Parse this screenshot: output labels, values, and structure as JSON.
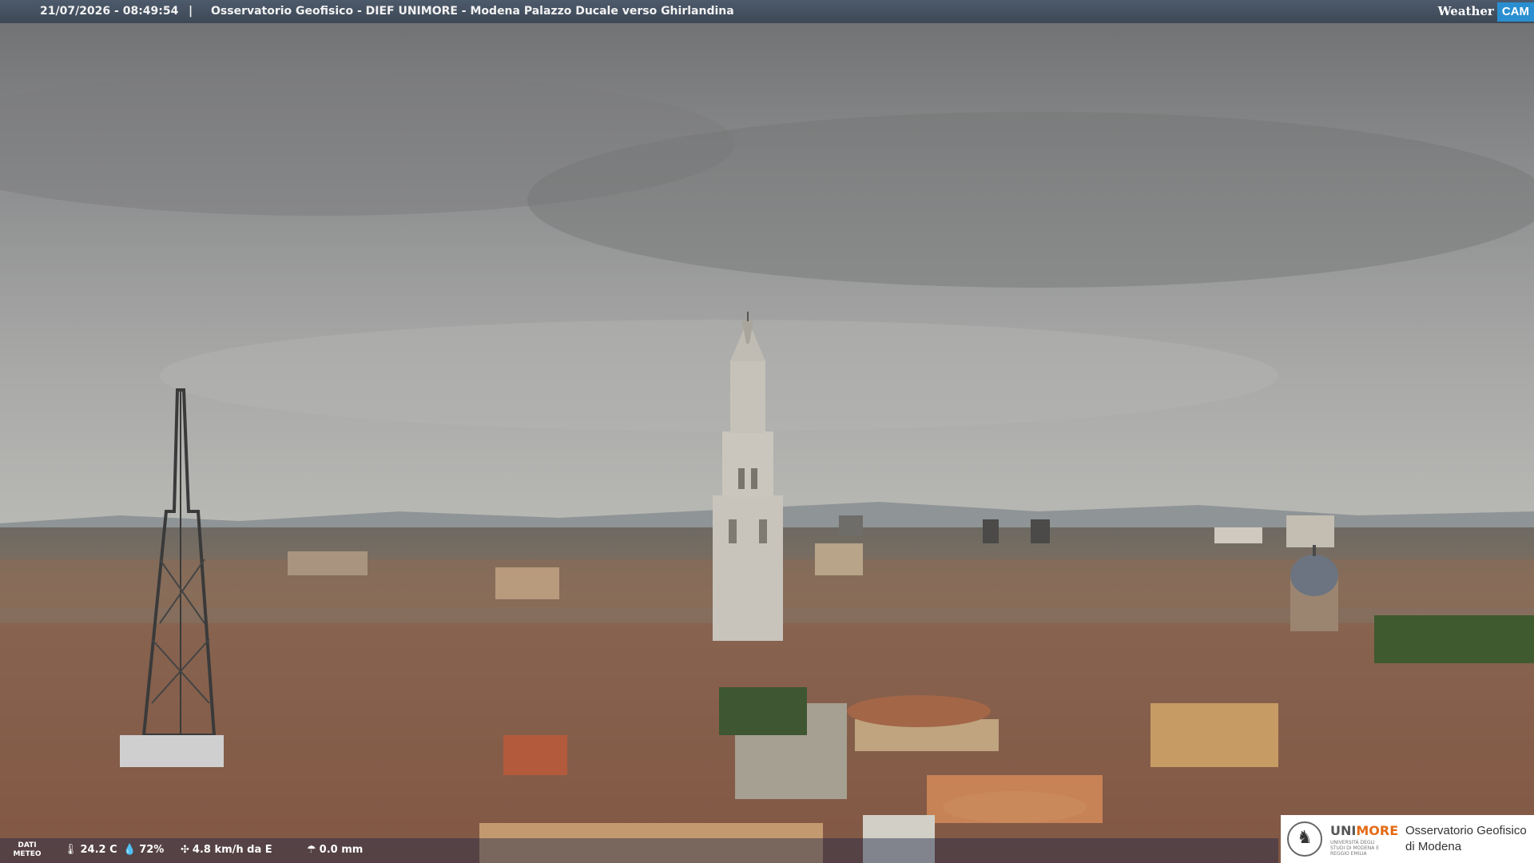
{
  "header": {
    "timestamp": "21/07/2026 - 08:49:54",
    "separator": "|",
    "title": "Osservatorio Geofisico - DIEF UNIMORE - Modena Palazzo Ducale verso Ghirlandina",
    "logo_weather": "Weather",
    "logo_cam": "CAM"
  },
  "weather": {
    "label": "DATI METEO",
    "temperature": "24.2 C",
    "humidity": "72%",
    "wind": "4.8 km/h da E",
    "rain": "0.0 mm"
  },
  "footer_logo": {
    "brand_left": "UNI",
    "brand_right": "MORE",
    "subtitle": "UNIVERSITÀ DEGLI STUDI DI MODENA E REGGIO EMILIA",
    "observatory_line1": "Osservatorio Geofisico",
    "observatory_line2": "di Modena"
  },
  "colors": {
    "sky": "#9a9b9a",
    "roofs": "#8a5e4a",
    "tower": "#c9c5bd",
    "header_bar": "#46525f",
    "logo_accent": "#e36b16",
    "cam_badge": "#2a8fd0"
  }
}
